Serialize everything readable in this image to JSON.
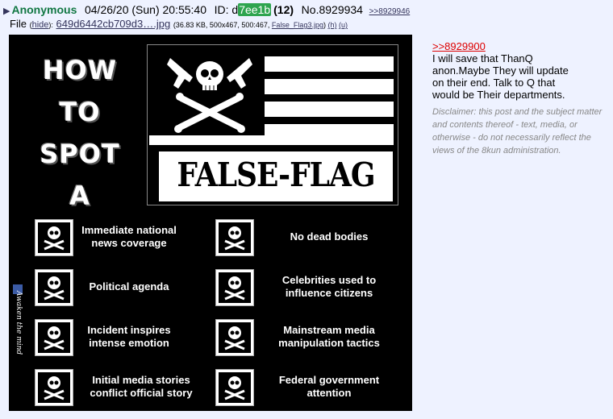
{
  "header": {
    "triangle": "▶",
    "name": "Anonymous",
    "date": "04/26/20 (Sun) 20:55:40",
    "id_label": "ID: ",
    "id_prefix": "d",
    "id_highlight": "7ee1b",
    "count": "(12)",
    "post_number": "No.8929934",
    "backlink": ">>8929946"
  },
  "file": {
    "label": "File",
    "hide_open": "(",
    "hide": "hide",
    "hide_close": "):",
    "filename": "649d6442cb709d3….jpg",
    "meta": "(36.83 KB, 500x467, 500:467,",
    "original": "False_Flag3.jpg",
    "h": "(h)",
    "u": "(u)"
  },
  "poster": {
    "how_to": [
      "HOW",
      "TO",
      "SPOT",
      "A"
    ],
    "banner": "FALSE-FLAG",
    "items_left": [
      "Immediate national news coverage",
      "Political agenda",
      "Incident inspires intense emotion",
      "Initial media stories conflict official story"
    ],
    "items_right": [
      "No dead bodies",
      "Celebrities used to influence citizens",
      "Mainstream media manipulation tactics",
      "Federal government attention"
    ],
    "watermark": "Awaken the mind",
    "icons": [
      "skull-crossbones-icon",
      "revolver-icon",
      "facebook-icon"
    ]
  },
  "reply": {
    "quote": ">>8929900",
    "lines": [
      "I will save that ThanQ",
      "anon.Maybe They will update",
      "on their end. Talk to Q that",
      "would be Their departments."
    ],
    "disclaimer": "Disclaimer: this post and the subject matter and contents thereof - text, media, or otherwise - do not necessarily reflect the views of the 8kun administration."
  },
  "colors": {
    "background": "#eef2ff",
    "name": "#117743",
    "id_highlight": "#2ea44f",
    "link": "#34345c",
    "quote": "#dd0000",
    "disclaimer": "#888888"
  }
}
